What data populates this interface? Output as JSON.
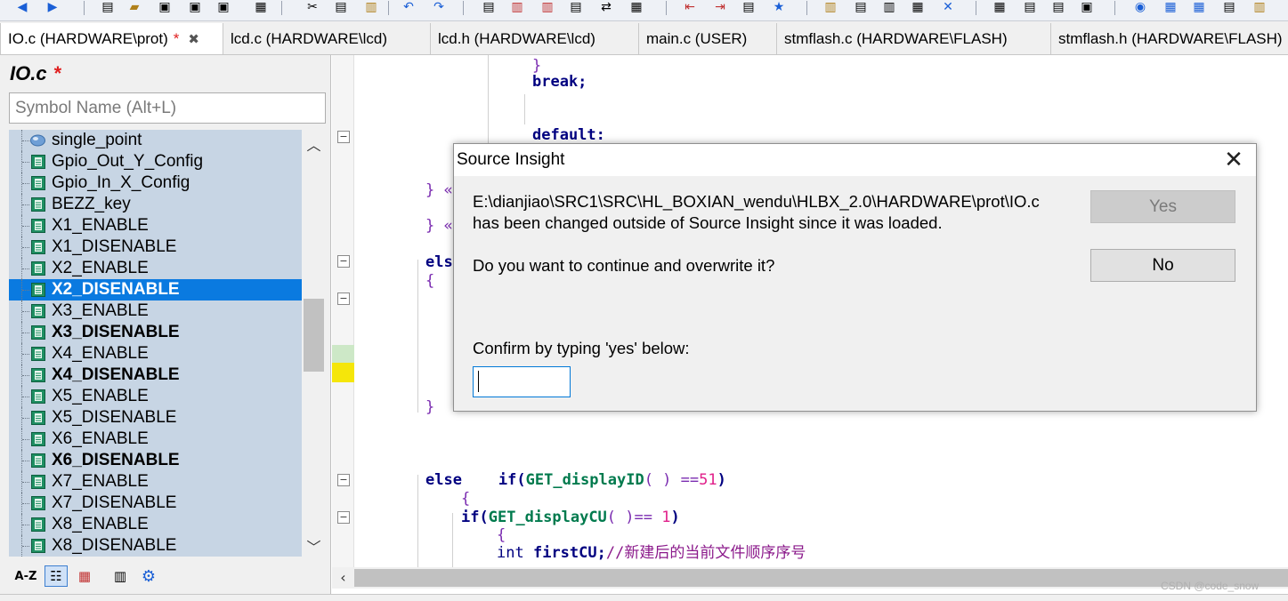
{
  "tabs": [
    {
      "label": "IO.c (HARDWARE\\prot)",
      "modified": "*",
      "close": "✖"
    },
    {
      "label": "lcd.c (HARDWARE\\lcd)"
    },
    {
      "label": "lcd.h (HARDWARE\\lcd)"
    },
    {
      "label": "main.c (USER)"
    },
    {
      "label": "stmflash.c (HARDWARE\\FLASH)"
    },
    {
      "label": "stmflash.h (HARDWARE\\FLASH)"
    }
  ],
  "symbol_panel": {
    "title": "IO.c",
    "modified": "*",
    "search_placeholder": "Symbol Name (Alt+L)",
    "items": [
      {
        "label": "single_point"
      },
      {
        "label": "Gpio_Out_Y_Config"
      },
      {
        "label": "Gpio_In_X_Config"
      },
      {
        "label": "BEZZ_key"
      },
      {
        "label": "X1_ENABLE"
      },
      {
        "label": "X1_DISENABLE"
      },
      {
        "label": "X2_ENABLE"
      },
      {
        "label": "X2_DISENABLE"
      },
      {
        "label": "X3_ENABLE"
      },
      {
        "label": "X3_DISENABLE"
      },
      {
        "label": "X4_ENABLE"
      },
      {
        "label": "X4_DISENABLE"
      },
      {
        "label": "X5_ENABLE"
      },
      {
        "label": "X5_DISENABLE"
      },
      {
        "label": "X6_ENABLE"
      },
      {
        "label": "X6_DISENABLE"
      },
      {
        "label": "X7_ENABLE"
      },
      {
        "label": "X7_DISENABLE"
      },
      {
        "label": "X8_ENABLE"
      },
      {
        "label": "X8_DISENABLE"
      }
    ]
  },
  "editor": {
    "line1": "}",
    "line2": "break;",
    "line3": "default:",
    "line4": "} «",
    "line5": "} «",
    "line6": "els",
    "line7": "{",
    "line8": "}",
    "l9_else": "else",
    "l9_if": "if",
    "l9_open": "(",
    "l9_fn": "GET_displayID",
    "l9_mid": "( ) ==",
    "l9_num": "51",
    "l9_close": ")",
    "l10": "{",
    "l11_if": "if",
    "l11_open": "(",
    "l11_fn": "GET_displayCU",
    "l11_mid": "( )== ",
    "l11_num": "1",
    "l11_close": ")",
    "l12": "{",
    "l13_type": "int",
    "l13_var": "firstCU;",
    "l13_cmt": "//新建后的当前文件顺序序号"
  },
  "dialog": {
    "title": "Source Insight",
    "close": "✕",
    "path": "E:\\dianjiao\\SRC1\\SRC\\HL_BOXIAN_wendu\\HLBX_2.0\\HARDWARE\\prot\\IO.c",
    "message": "has been changed outside of Source Insight since it was loaded.",
    "question": "Do you want to continue and overwrite it?",
    "confirm_label": "Confirm by typing 'yes' below:",
    "confirm_value": "",
    "yes_label": "Yes",
    "no_label": "No"
  },
  "watermark": "CSDN @code_snow",
  "colors": {
    "selection": "#0a7ae0",
    "list_bg": "#c7d5e4",
    "modified": "#e02020"
  }
}
